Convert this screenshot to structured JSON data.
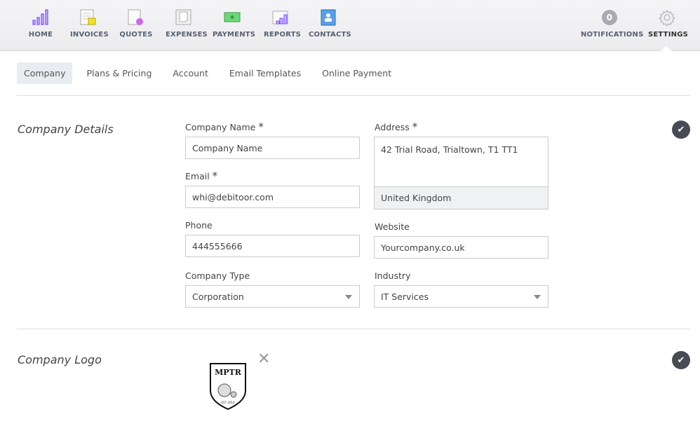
{
  "nav": {
    "items": [
      {
        "label": "HOME",
        "icon": "home-chart-icon"
      },
      {
        "label": "INVOICES",
        "icon": "invoices-icon"
      },
      {
        "label": "QUOTES",
        "icon": "quotes-icon"
      },
      {
        "label": "EXPENSES",
        "icon": "expenses-icon"
      },
      {
        "label": "PAYMENTS",
        "icon": "payments-icon"
      },
      {
        "label": "REPORTS",
        "icon": "reports-icon"
      },
      {
        "label": "CONTACTS",
        "icon": "contacts-icon"
      }
    ],
    "notifications": {
      "label": "NOTIFICATIONS",
      "count": "0"
    },
    "settings": {
      "label": "SETTINGS",
      "icon": "gear-icon"
    }
  },
  "tabs": [
    {
      "label": "Company",
      "active": true
    },
    {
      "label": "Plans & Pricing"
    },
    {
      "label": "Account"
    },
    {
      "label": "Email Templates"
    },
    {
      "label": "Online Payment"
    }
  ],
  "details": {
    "title": "Company Details",
    "company_name": {
      "label": "Company Name",
      "required": "*",
      "value": "Company Name"
    },
    "email": {
      "label": "Email",
      "required": "*",
      "value": "whi@debitoor.com"
    },
    "phone": {
      "label": "Phone",
      "value": "444555666"
    },
    "company_type": {
      "label": "Company Type",
      "value": "Corporation"
    },
    "address": {
      "label": "Address",
      "required": "*",
      "value": "42 Trial Road, Trialtown, T1 TT1",
      "country": "United Kingdom"
    },
    "website": {
      "label": "Website",
      "value": "Yourcompany.co.uk"
    },
    "industry": {
      "label": "Industry",
      "value": "IT Services"
    }
  },
  "logo": {
    "title": "Company Logo",
    "logo_text": "MPTR",
    "logo_est": "EST 2014"
  },
  "colors": {
    "accent": "#7b4dff",
    "check": "#4a4a55"
  }
}
